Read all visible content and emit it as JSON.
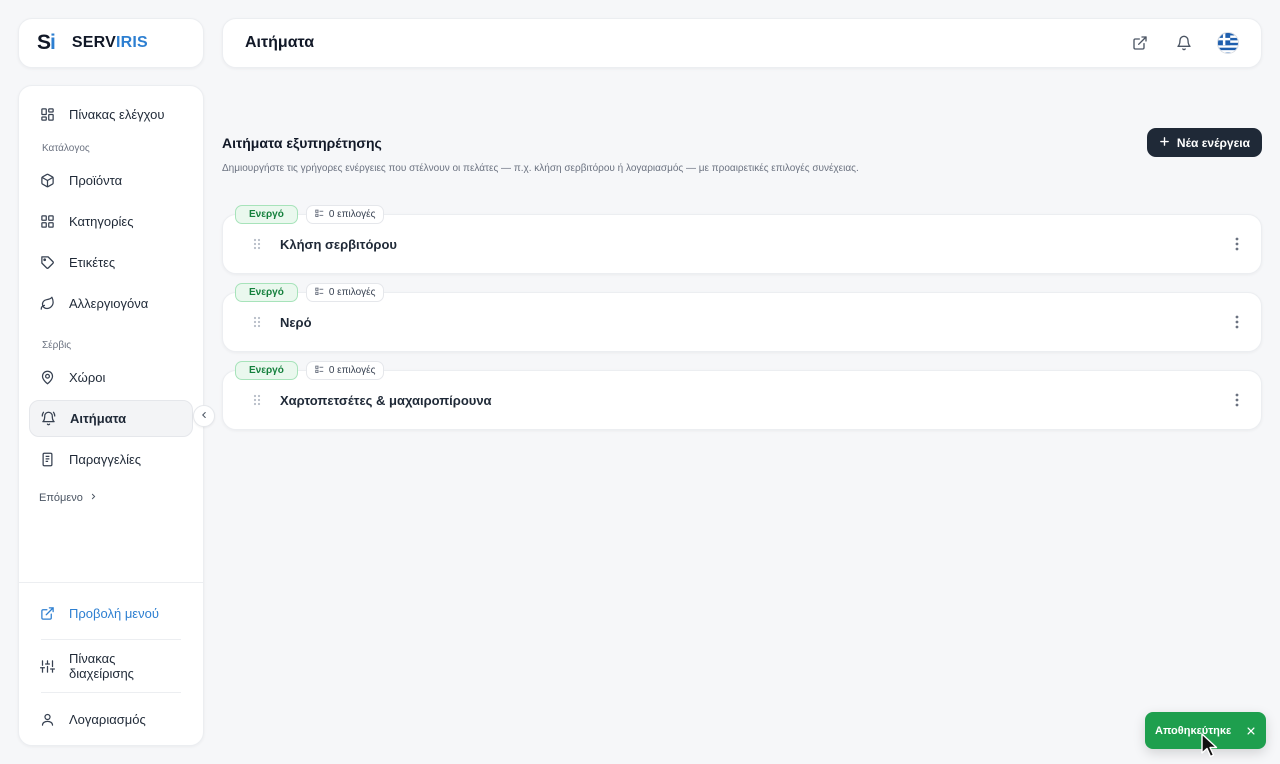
{
  "brand": {
    "mark_s": "S",
    "mark_i": "i",
    "name_a": "SERV",
    "name_b": "IRIS",
    "accent": "#2d7fd1"
  },
  "header": {
    "title": "Αιτήματα"
  },
  "sidebar": {
    "items": [
      {
        "label": "Πίνακας ελέγχου",
        "icon": "dashboard-icon"
      },
      {
        "section": "Κατάλογος"
      },
      {
        "label": "Προϊόντα",
        "icon": "box-icon"
      },
      {
        "label": "Κατηγορίες",
        "icon": "grid-icon"
      },
      {
        "label": "Ετικέτες",
        "icon": "tag-icon"
      },
      {
        "label": "Αλλεργιογόνα",
        "icon": "leaf-icon"
      },
      {
        "section": "Σέρβις"
      },
      {
        "label": "Χώροι",
        "icon": "location-icon"
      },
      {
        "label": "Αιτήματα",
        "icon": "bell-ring-icon",
        "active": true
      },
      {
        "label": "Παραγγελίες",
        "icon": "receipt-icon"
      }
    ],
    "more_label": "Επόμενο",
    "bottom": {
      "menu_preview": "Προβολή μενού",
      "admin_panel": "Πίνακας διαχείρισης",
      "account": "Λογαριασμός"
    }
  },
  "main": {
    "title": "Αιτήματα εξυπηρέτησης",
    "description": "Δημιουργήστε τις γρήγορες ενέργειες που στέλνουν οι πελάτες — π.χ. κλήση σερβιτόρου ή λογαριασμός — με προαιρετικές επιλογές συνέχειας.",
    "new_button": "Νέα ενέργεια",
    "requests": [
      {
        "status": "Ενεργό",
        "options": "0 επιλογές",
        "name": "Κλήση σερβιτόρου"
      },
      {
        "status": "Ενεργό",
        "options": "0 επιλογές",
        "name": "Νερό"
      },
      {
        "status": "Ενεργό",
        "options": "0 επιλογές",
        "name": "Χαρτοπετσέτες & μαχαιροπίρουνα"
      }
    ]
  },
  "toast": {
    "message": "Αποθηκεύτηκε",
    "color": "#1e9f4e"
  }
}
